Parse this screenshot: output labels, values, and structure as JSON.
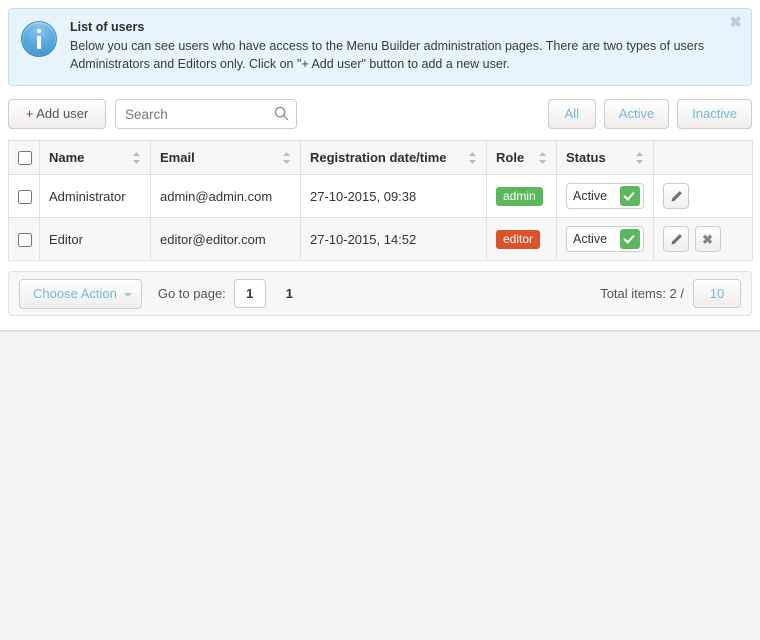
{
  "alert": {
    "icon": "info-circle-icon",
    "title": "List of users",
    "text": "Below you can see users who have access to the Menu Builder administration pages. There are two types of users Administrators and Editors only. Click on \"+ Add user\" button to add a new user.",
    "close_label": "✖"
  },
  "toolbar": {
    "add_user_label": "+ Add user",
    "search_placeholder": "Search",
    "search_value": "",
    "filters": [
      {
        "label": "All",
        "name": "filter-all"
      },
      {
        "label": "Active",
        "name": "filter-active"
      },
      {
        "label": "Inactive",
        "name": "filter-inactive"
      }
    ]
  },
  "table": {
    "columns": [
      {
        "label": "Name",
        "sortable": true
      },
      {
        "label": "Email",
        "sortable": true
      },
      {
        "label": "Registration date/time",
        "sortable": true
      },
      {
        "label": "Role",
        "sortable": true
      },
      {
        "label": "Status",
        "sortable": true
      }
    ],
    "rows": [
      {
        "name": "Administrator",
        "email": "admin@admin.com",
        "registration": "27-10-2015, 09:38",
        "role": "admin",
        "role_color": "#5cb85c",
        "status": "Active",
        "has_delete": false
      },
      {
        "name": "Editor",
        "email": "editor@editor.com",
        "registration": "27-10-2015, 14:52",
        "role": "editor",
        "role_color": "#d9542b",
        "status": "Active",
        "has_delete": true
      }
    ]
  },
  "footer": {
    "choose_action_label": "Choose Action",
    "goto_label": "Go to page:",
    "page_value": "1",
    "current_page": "1",
    "total_label": "Total items: 2 /",
    "per_page": "10"
  },
  "colors": {
    "accent_blue": "#73b7e0",
    "alert_bg": "#e7f4fb",
    "alert_border": "#bfe3f3",
    "admin_badge": "#5cb85c",
    "editor_badge": "#d9542b",
    "status_green": "#5cb85c",
    "page_bg": "#f4f2f4"
  }
}
